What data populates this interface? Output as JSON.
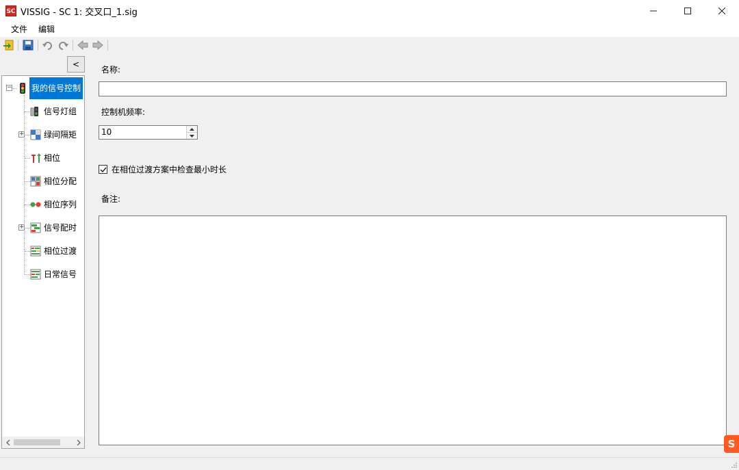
{
  "window": {
    "app_icon_text": "SC",
    "title": "VISSIG - SC 1: 交叉口_1.sig",
    "minimize": "—",
    "maximize": "☐",
    "close": "✕"
  },
  "menu": {
    "items": [
      {
        "label": "文件"
      },
      {
        "label": "编辑"
      }
    ]
  },
  "toolbar": {
    "icons": [
      "import-icon",
      "save-icon",
      "undo-icon",
      "redo-icon",
      "back-icon",
      "forward-icon"
    ]
  },
  "tree": {
    "collapse_label": "<",
    "root": {
      "label": "我的信号控制",
      "expander": "−",
      "icon": "traffic-light-icon"
    },
    "children": [
      {
        "label": "信号灯组",
        "icon": "signal-group-icon",
        "expander": ""
      },
      {
        "label": "绿间隔矩",
        "icon": "intergreen-icon",
        "expander": "+"
      },
      {
        "label": "相位",
        "icon": "phase-icon",
        "expander": ""
      },
      {
        "label": "相位分配",
        "icon": "phase-assignment-icon",
        "expander": ""
      },
      {
        "label": "相位序列",
        "icon": "phase-sequence-icon",
        "expander": ""
      },
      {
        "label": "信号配时",
        "icon": "signal-timing-icon",
        "expander": "+"
      },
      {
        "label": "相位过渡",
        "icon": "phase-transition-icon",
        "expander": ""
      },
      {
        "label": "日常信号",
        "icon": "daily-signal-icon",
        "expander": ""
      }
    ]
  },
  "form": {
    "name_label": "名称:",
    "name_value": "",
    "frequency_label": "控制机频率:",
    "frequency_value": "10",
    "check_min_duration_label": "在相位过渡方案中检查最小时长",
    "check_min_duration_checked": true,
    "notes_label": "备注:",
    "notes_value": ""
  },
  "colors": {
    "selection": "#0078d7",
    "app_icon": "#d9261c",
    "ime_badge": "#ff5a1f"
  },
  "ime_badge_text": "S"
}
